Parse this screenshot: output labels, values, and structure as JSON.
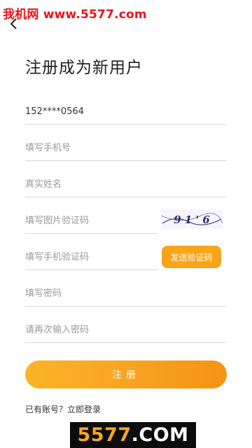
{
  "watermark": {
    "top_text": "我机网 www.5577.com",
    "bottom_accent": "5577",
    "bottom_rest": ".COM"
  },
  "header": {
    "back_icon": "chevron-left-icon",
    "title": "注册成为新用户"
  },
  "form": {
    "account_value": "152****0564",
    "phone_placeholder": "填写手机号",
    "real_name_placeholder": "真实姓名",
    "image_captcha_placeholder": "填写图片验证码",
    "captcha_text": "9 1 ' 6",
    "sms_code_placeholder": "填写手机验证码",
    "send_code_label": "发送验证码",
    "password_placeholder": "填写密码",
    "confirm_password_placeholder": "请再次输入密码",
    "register_label": "注册"
  },
  "footer": {
    "login_link": "已有账号？立即登录"
  },
  "colors": {
    "accent": "#f8a51c",
    "watermark_red": "#e8141a",
    "divider": "#d9d9d9"
  }
}
